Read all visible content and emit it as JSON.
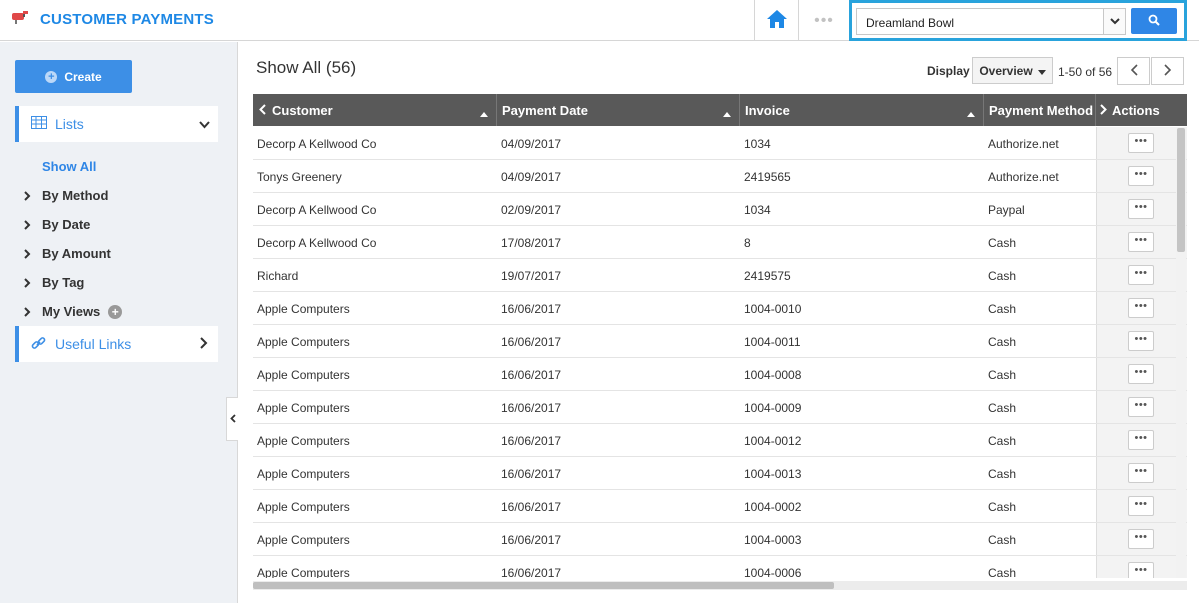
{
  "app": {
    "title": "CUSTOMER PAYMENTS",
    "logo_icon": "mailbox-icon"
  },
  "topbar": {
    "search_value": "Dreamland Bowl",
    "more_label": "•••"
  },
  "sidebar": {
    "create_label": "Create",
    "lists_label": "Lists",
    "show_all": "Show All",
    "items": [
      "By Method",
      "By Date",
      "By Amount",
      "By Tag",
      "My Views"
    ],
    "useful_links_label": "Useful Links"
  },
  "main": {
    "title": "Show All (56)",
    "display_label": "Display",
    "display_value": "Overview",
    "pager": "1-50 of 56"
  },
  "grid": {
    "columns": [
      "Customer",
      "Payment Date",
      "Invoice",
      "Payment Method",
      "Actions"
    ],
    "action_label": "•••",
    "rows": [
      [
        "Decorp A Kellwood Co",
        "04/09/2017",
        "1034",
        "Authorize.net"
      ],
      [
        "Tonys Greenery",
        "04/09/2017",
        "2419565",
        "Authorize.net"
      ],
      [
        "Decorp A Kellwood Co",
        "02/09/2017",
        "1034",
        "Paypal"
      ],
      [
        "Decorp A Kellwood Co",
        "17/08/2017",
        "8",
        "Cash"
      ],
      [
        "Richard",
        "19/07/2017",
        "2419575",
        "Cash"
      ],
      [
        "Apple Computers",
        "16/06/2017",
        "1004-0010",
        "Cash"
      ],
      [
        "Apple Computers",
        "16/06/2017",
        "1004-0011",
        "Cash"
      ],
      [
        "Apple Computers",
        "16/06/2017",
        "1004-0008",
        "Cash"
      ],
      [
        "Apple Computers",
        "16/06/2017",
        "1004-0009",
        "Cash"
      ],
      [
        "Apple Computers",
        "16/06/2017",
        "1004-0012",
        "Cash"
      ],
      [
        "Apple Computers",
        "16/06/2017",
        "1004-0013",
        "Cash"
      ],
      [
        "Apple Computers",
        "16/06/2017",
        "1004-0002",
        "Cash"
      ],
      [
        "Apple Computers",
        "16/06/2017",
        "1004-0003",
        "Cash"
      ],
      [
        "Apple Computers",
        "16/06/2017",
        "1004-0006",
        "Cash"
      ]
    ]
  },
  "colors": {
    "accent": "#2f86e6",
    "header_bg": "#595959",
    "search_border": "#29a3dc"
  }
}
